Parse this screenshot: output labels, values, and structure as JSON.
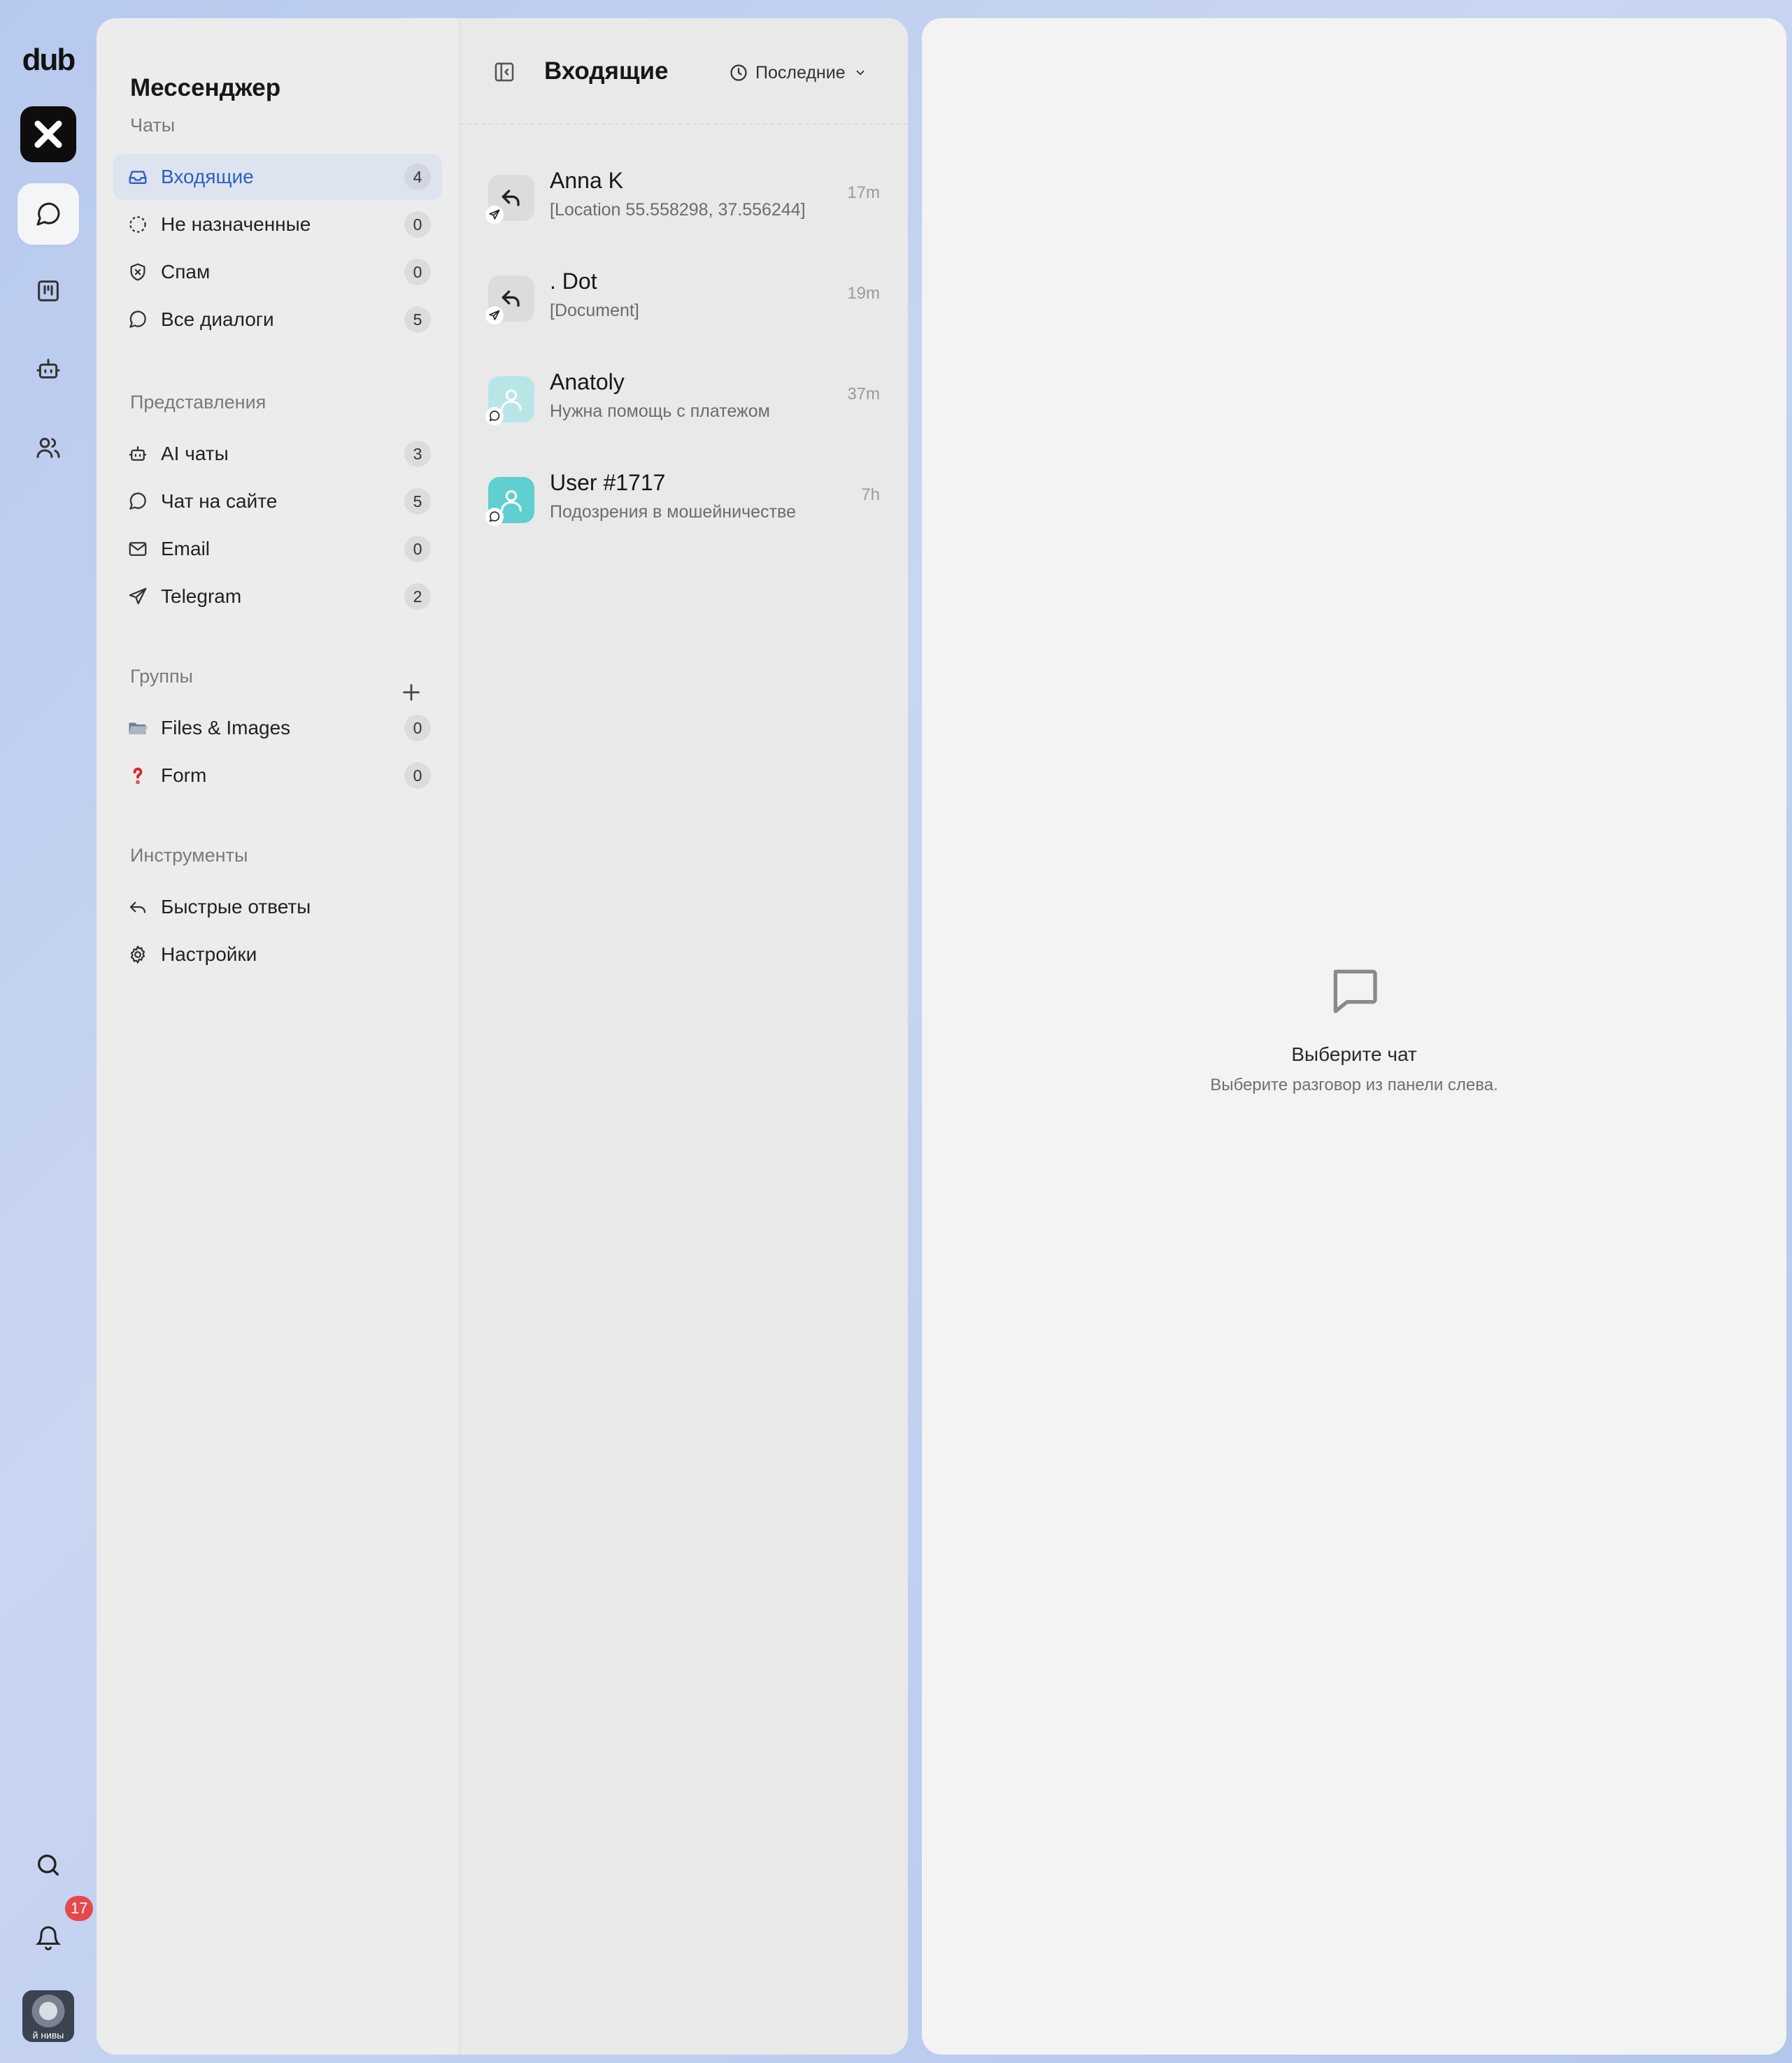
{
  "rail": {
    "logo": "dub",
    "nav_icons": [
      "chat-icon",
      "kanban-icon",
      "bot-icon",
      "users-icon"
    ],
    "bottom_icons": [
      "search-icon",
      "bell-icon"
    ],
    "notifications_count": "17",
    "avatar_caption": "й нивы"
  },
  "sidebar": {
    "title": "Мессенджер",
    "sections": {
      "chats": "Чаты",
      "views": "Представления",
      "groups": "Группы",
      "tools": "Инструменты"
    },
    "chats": [
      {
        "label": "Входящие",
        "count": "4",
        "icon": "inbox-icon",
        "active": true
      },
      {
        "label": "Не назначенные",
        "count": "0",
        "icon": "dashed-circle-icon"
      },
      {
        "label": "Спам",
        "count": "0",
        "icon": "shield-x-icon"
      },
      {
        "label": "Все диалоги",
        "count": "5",
        "icon": "message-circle-icon"
      }
    ],
    "views": [
      {
        "label": "AI чаты",
        "count": "3",
        "icon": "bot-icon"
      },
      {
        "label": "Чат на сайте",
        "count": "5",
        "icon": "message-circle-icon"
      },
      {
        "label": "Email",
        "count": "0",
        "icon": "mail-icon"
      },
      {
        "label": "Telegram",
        "count": "2",
        "icon": "send-icon"
      }
    ],
    "groups": [
      {
        "label": "Files & Images",
        "count": "0",
        "icon": "folder-emoji-icon"
      },
      {
        "label": "Form",
        "count": "0",
        "icon": "question-emoji-icon"
      }
    ],
    "tools": [
      {
        "label": "Быстрые ответы",
        "icon": "reply-icon"
      },
      {
        "label": "Настройки",
        "icon": "gear-icon"
      }
    ]
  },
  "list": {
    "title": "Входящие",
    "sort_label": "Последние",
    "chats": [
      {
        "name": "Anna K",
        "preview": "[Location 55.558298, 37.556244]",
        "time": "17m",
        "channel": "telegram"
      },
      {
        "name": ". Dot",
        "preview": "[Document]",
        "time": "19m",
        "channel": "telegram"
      },
      {
        "name": "Anatoly",
        "preview": "Нужна помощь с платежом",
        "time": "37m",
        "channel": "web-chat"
      },
      {
        "name": "User #1717",
        "preview": "Подозрения в мошейничестве",
        "time": "7h",
        "channel": "web-chat"
      }
    ]
  },
  "detail": {
    "empty_title": "Выберите чат",
    "empty_subtitle": "Выберите разговор из панели слева."
  },
  "colors": {
    "accent": "#2f5ec4",
    "active_bg": "#dde4f0",
    "badge_red": "#e5484d",
    "teal_avatar": "#5fd0cf"
  }
}
